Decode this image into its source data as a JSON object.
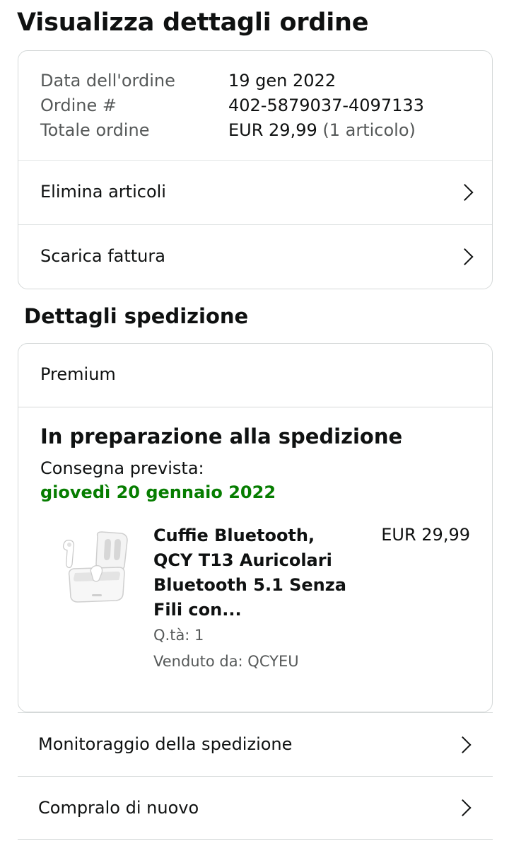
{
  "page": {
    "title": "Visualizza dettagli ordine"
  },
  "order": {
    "date_label": "Data dell'ordine",
    "date_value": "19 gen 2022",
    "number_label": "Ordine #",
    "number_value": "402-5879037-4097133",
    "total_label": "Totale ordine",
    "total_value": "EUR 29,99",
    "total_items": "(1 articolo)"
  },
  "order_actions": {
    "remove_items": "Elimina articoli",
    "download_invoice": "Scarica fattura"
  },
  "shipping": {
    "section_title": "Dettagli spedizione",
    "service": "Premium",
    "status": "In preparazione alla spedizione",
    "delivery_label": "Consegna prevista:",
    "delivery_date": "giovedì 20 gennaio 2022",
    "delivery_date_color": "#067d00"
  },
  "product": {
    "title": "Cuffie Bluetooth, QCY T13 Auricolari Bluetooth 5.1 Senza Fili con...",
    "price": "EUR 29,99",
    "quantity": "Q.tà: 1",
    "seller": "Venduto da: QCYEU",
    "image_icon": "wireless-earbuds-case-image"
  },
  "bottom_actions": {
    "track_shipment": "Monitoraggio della spedizione",
    "buy_again": "Compralo di nuovo"
  },
  "icons": {
    "chevron": "chevron-right-icon"
  }
}
